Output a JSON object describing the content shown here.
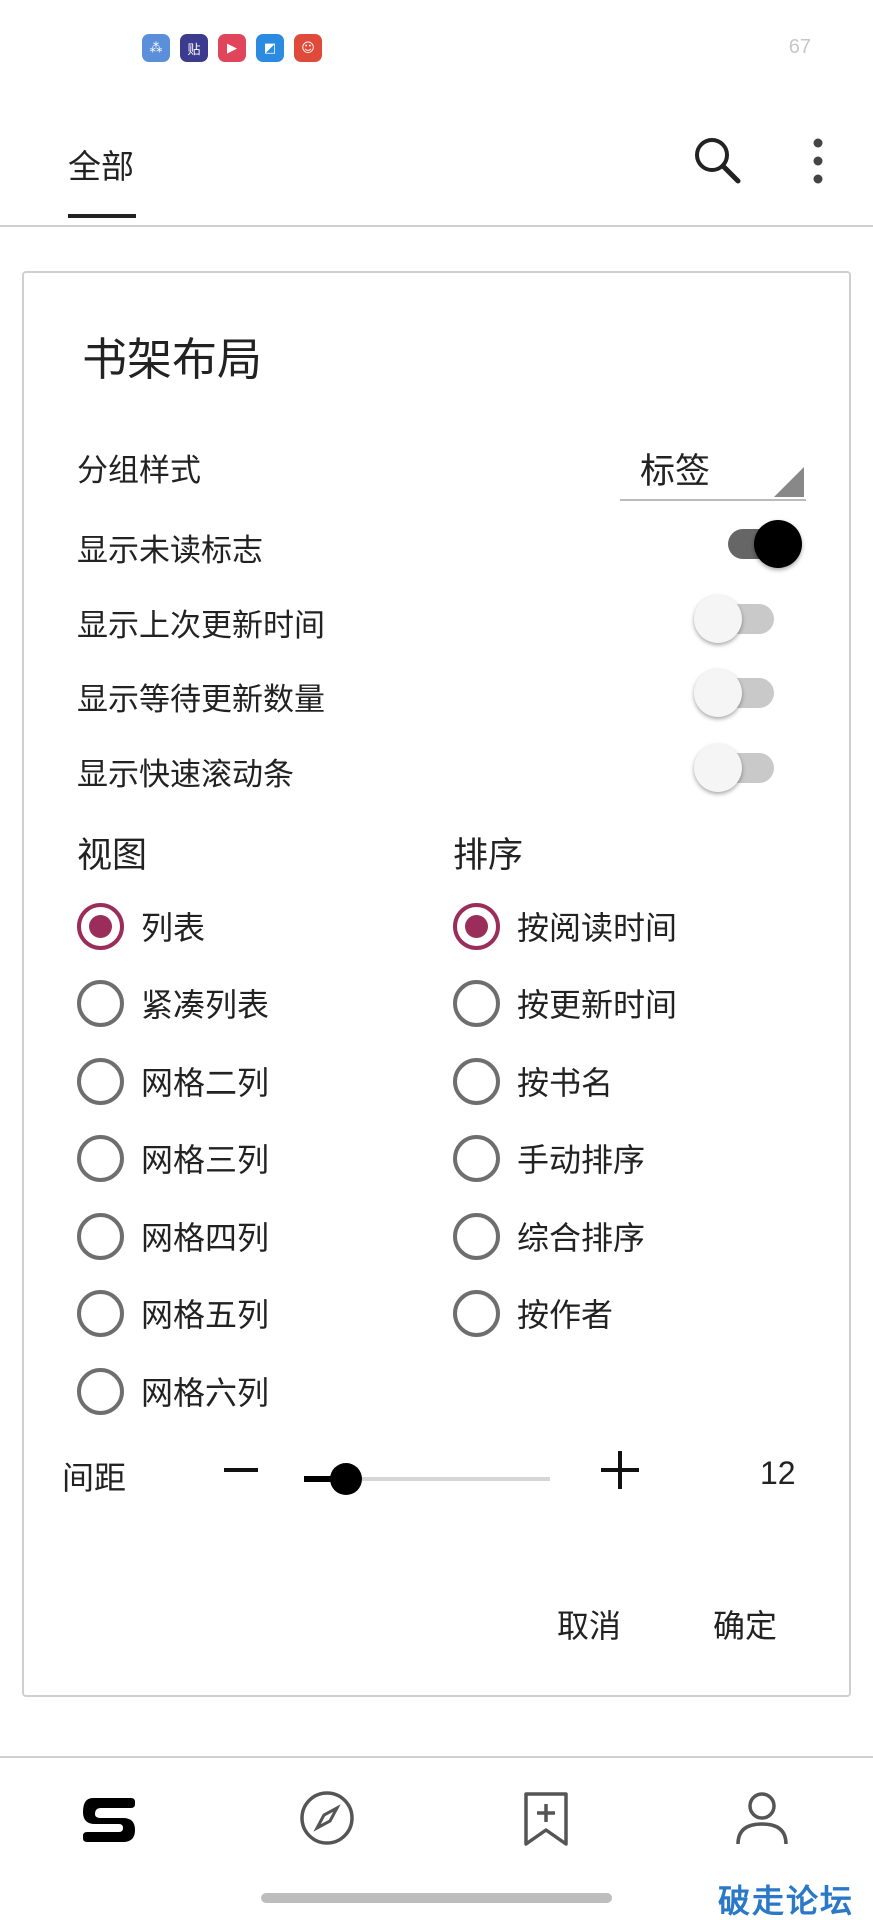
{
  "status_bar": {
    "icons": [
      "cloud-app-icon",
      "tieba-app-icon",
      "video-app-icon",
      "browser-app-icon",
      "game-app-icon"
    ],
    "icon_colors": [
      "#5b8fd9",
      "#3b3b8f",
      "#e0455c",
      "#2a8be0",
      "#e04a3a"
    ],
    "icon_glyphs": [
      "⁂",
      "贴",
      "▶",
      "◩",
      "☺"
    ],
    "battery": "67"
  },
  "app_bar": {
    "tab_label": "全部"
  },
  "dialog": {
    "title": "书架布局",
    "group_style": {
      "label": "分组样式",
      "value": "标签"
    },
    "toggles": [
      {
        "label": "显示未读标志",
        "on": true
      },
      {
        "label": "显示上次更新时间",
        "on": false
      },
      {
        "label": "显示等待更新数量",
        "on": false
      },
      {
        "label": "显示快速滚动条",
        "on": false
      }
    ],
    "view": {
      "heading": "视图",
      "options": [
        "列表",
        "紧凑列表",
        "网格二列",
        "网格三列",
        "网格四列",
        "网格五列",
        "网格六列"
      ],
      "selected_index": 0
    },
    "sort": {
      "heading": "排序",
      "options": [
        "按阅读时间",
        "按更新时间",
        "按书名",
        "手动排序",
        "综合排序",
        "按作者"
      ],
      "selected_index": 0
    },
    "spacing": {
      "label": "间距",
      "value": "12",
      "slider_fraction": 0.17
    },
    "cancel_label": "取消",
    "confirm_label": "确定"
  },
  "bottom_nav": {
    "items": [
      "bookshelf-icon",
      "explore-icon",
      "bookmark-add-icon",
      "profile-icon"
    ]
  },
  "watermark": "破走论坛",
  "colors": {
    "accent": "#9b2d5a",
    "switch_on_thumb": "#000000",
    "switch_on_track": "#666666"
  }
}
